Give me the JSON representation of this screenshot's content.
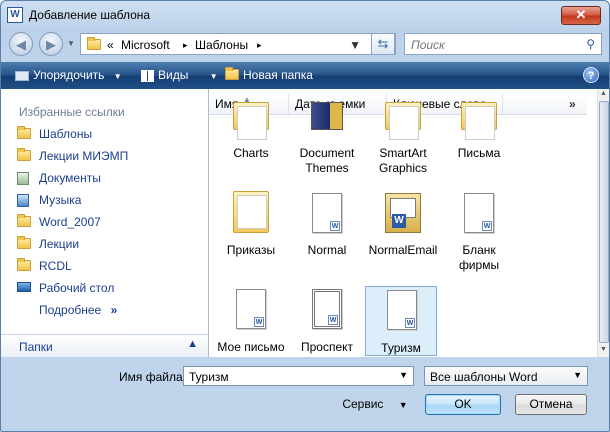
{
  "window": {
    "title": "Добавление шаблона",
    "close_glyph": "✕"
  },
  "address": {
    "prefix": "«",
    "path": [
      "Microsoft",
      "Шаблоны"
    ],
    "separator": "▸",
    "search_placeholder": "Поиск"
  },
  "toolbar": {
    "organize": "Упорядочить",
    "views": "Виды",
    "new_folder": "Новая папка",
    "help": "?"
  },
  "nav": {
    "heading": "Избранные ссылки",
    "favorites": [
      {
        "label": "Шаблоны",
        "icon": "folder-icon"
      },
      {
        "label": "Лекции МИЭМП",
        "icon": "folder-icon"
      },
      {
        "label": "Документы",
        "icon": "documents-icon"
      },
      {
        "label": "Музыка",
        "icon": "music-icon"
      },
      {
        "label": "Word_2007",
        "icon": "folder-icon"
      },
      {
        "label": "Лекции",
        "icon": "folder-icon"
      },
      {
        "label": "RCDL",
        "icon": "folder-icon"
      },
      {
        "label": "Рабочий стол",
        "icon": "desktop-icon"
      }
    ],
    "more": "Подробнее",
    "more_chevron": "»",
    "folders_label": "Папки",
    "folders_chevron": "▲"
  },
  "columns": {
    "name": "Имя",
    "date": "Дата съемки",
    "keywords": "Ключевые слова",
    "more": "»"
  },
  "files": [
    {
      "name": "Charts",
      "icon": "folder-icon"
    },
    {
      "name": "Document Themes",
      "icon": "folder-icon"
    },
    {
      "name": "SmartArt Graphics",
      "icon": "folder-icon"
    },
    {
      "name": "Письма",
      "icon": "folder-icon"
    },
    {
      "name": "Приказы",
      "icon": "folder-icon"
    },
    {
      "name": "Normal",
      "icon": "word-doc-icon"
    },
    {
      "name": "NormalEmail",
      "icon": "word-email-icon"
    },
    {
      "name": "Бланк фирмы",
      "icon": "word-doc-icon"
    },
    {
      "name": "Мое письмо",
      "icon": "word-doc-icon"
    },
    {
      "name": "Проспект",
      "icon": "word-doc-icon"
    },
    {
      "name": "Туризм",
      "icon": "word-doc-icon",
      "selected": true
    }
  ],
  "bottom": {
    "filename_label": "Имя файла:",
    "filename_value": "Туризм",
    "filter_value": "Все шаблоны Word",
    "service": "Сервис",
    "ok": "OK",
    "cancel": "Отмена"
  },
  "colors": {
    "toolbar_bg": "#1f5087",
    "link": "#1a3f8f",
    "selection": "#ddeefb",
    "close_button": "#c2351a"
  }
}
